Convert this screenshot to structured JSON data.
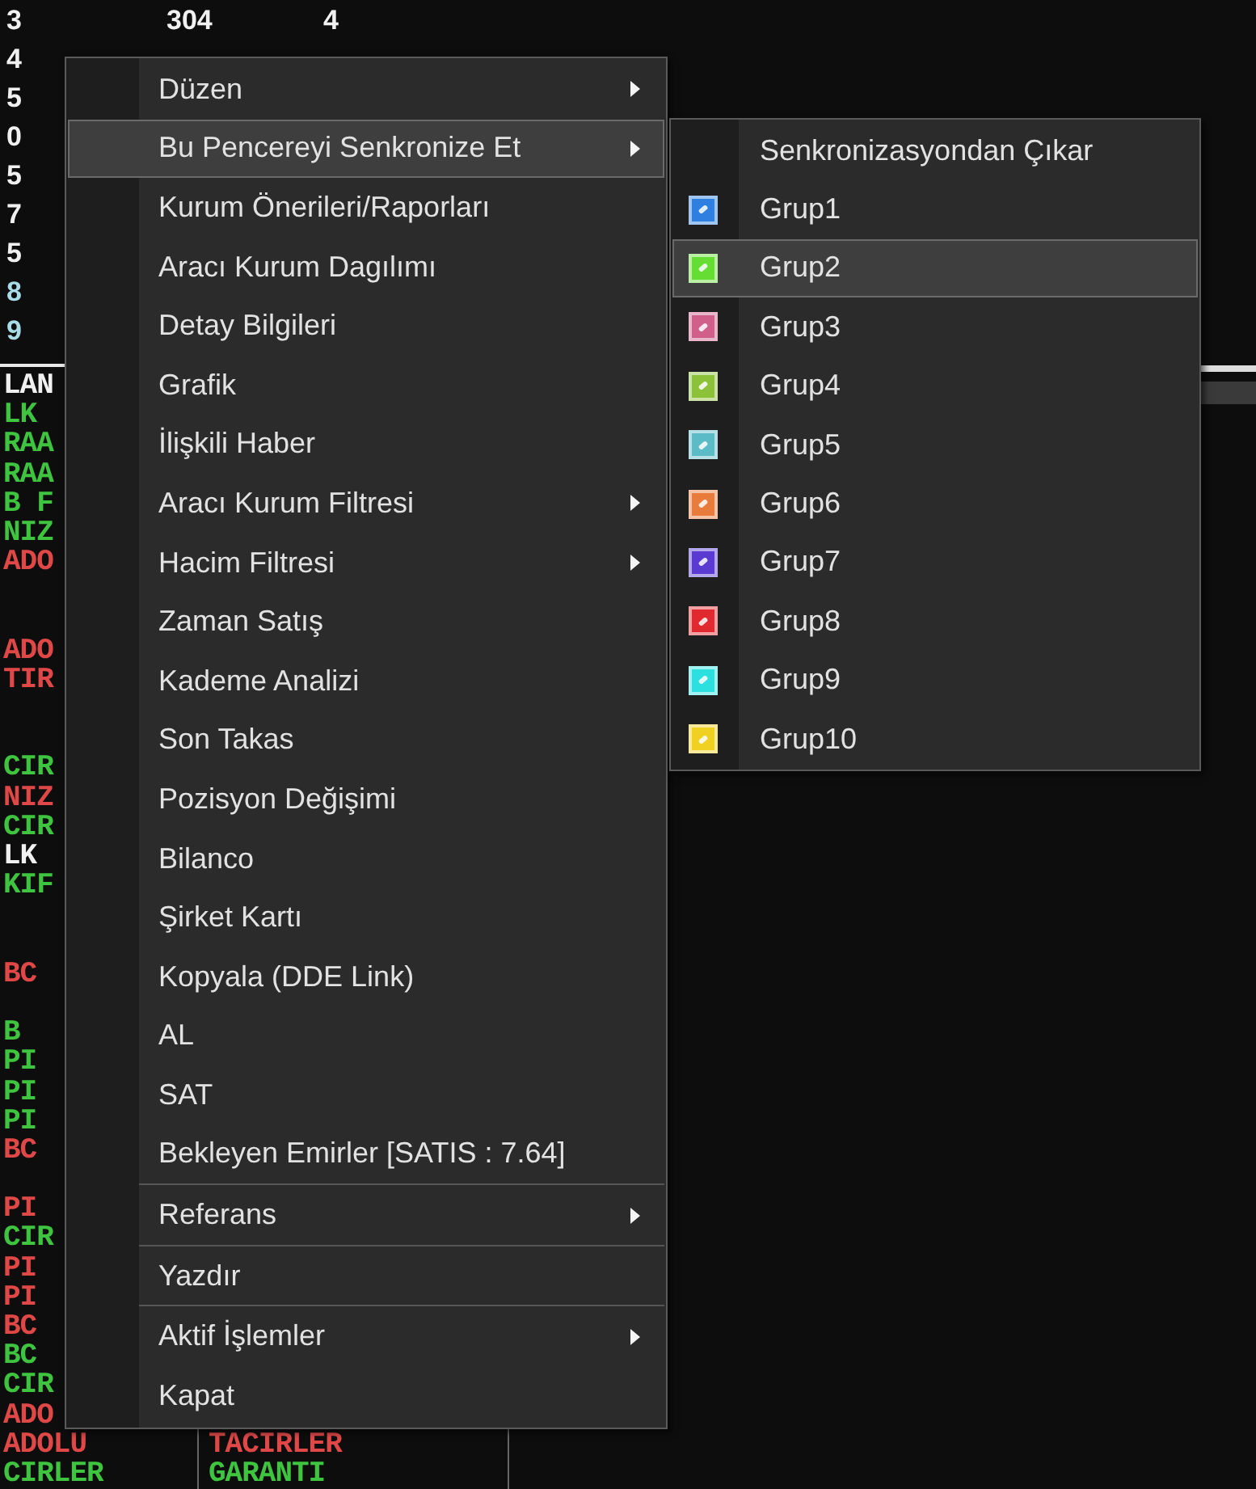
{
  "grid": {
    "top_rows": [
      {
        "cells": [
          "3",
          "304",
          "4"
        ],
        "color": "#f0f0f0"
      },
      {
        "cells": [
          "4"
        ],
        "color": "#f0f0f0"
      },
      {
        "cells": [
          "5"
        ],
        "color": "#f0f0f0"
      },
      {
        "cells": [
          "0"
        ],
        "color": "#f0f0f0"
      },
      {
        "cells": [
          "5"
        ],
        "color": "#f0f0f0"
      },
      {
        "cells": [
          "7"
        ],
        "color": "#f0f0f0"
      },
      {
        "cells": [
          "5"
        ],
        "color": "#f0f0f0"
      },
      {
        "cells": [
          "8"
        ],
        "color": "#a8dce6"
      },
      {
        "cells": [
          "9"
        ],
        "color": "#a8dce6"
      }
    ],
    "rows": [
      {
        "kind": "quote",
        "cells": [
          "LAN"
        ],
        "color": "#f0f0f0"
      },
      {
        "kind": "quote",
        "cells": [
          "LK"
        ],
        "color": "#3ec43e"
      },
      {
        "kind": "quote",
        "cells": [
          "RAA"
        ],
        "color": "#3ec43e"
      },
      {
        "kind": "quote",
        "cells": [
          "RAA"
        ],
        "color": "#3ec43e"
      },
      {
        "kind": "quote",
        "cells": [
          "B F"
        ],
        "color": "#3ec43e"
      },
      {
        "kind": "quote",
        "cells": [
          "NIZ"
        ],
        "color": "#3ec43e"
      },
      {
        "kind": "quote",
        "cells": [
          "ADO"
        ],
        "color": "#e04848"
      },
      {
        "kind": "empty"
      },
      {
        "kind": "empty"
      },
      {
        "kind": "quote",
        "cells": [
          "ADO"
        ],
        "color": "#e04848"
      },
      {
        "kind": "quote",
        "cells": [
          "TIR"
        ],
        "color": "#e04848"
      },
      {
        "kind": "empty"
      },
      {
        "kind": "empty"
      },
      {
        "kind": "quote",
        "cells": [
          "CIR"
        ],
        "color": "#3ec43e"
      },
      {
        "kind": "quote",
        "cells": [
          "NIZ"
        ],
        "color": "#e04848"
      },
      {
        "kind": "quote",
        "cells": [
          "CIR"
        ],
        "color": "#3ec43e"
      },
      {
        "kind": "quote",
        "cells": [
          "LK"
        ],
        "color": "#f0f0f0"
      },
      {
        "kind": "quote",
        "cells": [
          "KIF"
        ],
        "color": "#3ec43e"
      },
      {
        "kind": "empty"
      },
      {
        "kind": "empty"
      },
      {
        "kind": "quote",
        "cells": [
          "BC"
        ],
        "color": "#e04848"
      },
      {
        "kind": "empty"
      },
      {
        "kind": "quote",
        "cells": [
          "B"
        ],
        "color": "#3ec43e"
      },
      {
        "kind": "quote",
        "cells": [
          "PI"
        ],
        "color": "#3ec43e"
      },
      {
        "kind": "quote",
        "cells": [
          "PI"
        ],
        "color": "#3ec43e"
      },
      {
        "kind": "quote",
        "cells": [
          "PI"
        ],
        "color": "#3ec43e"
      },
      {
        "kind": "quote",
        "cells": [
          "BC"
        ],
        "color": "#e04848"
      },
      {
        "kind": "empty"
      },
      {
        "kind": "quote",
        "cells": [
          "PI"
        ],
        "color": "#e04848"
      },
      {
        "kind": "quote",
        "cells": [
          "CIR"
        ],
        "color": "#3ec43e"
      },
      {
        "kind": "quote",
        "cells": [
          "PI"
        ],
        "color": "#e04848"
      },
      {
        "kind": "quote",
        "cells": [
          "PI"
        ],
        "color": "#e04848"
      },
      {
        "kind": "quote",
        "cells": [
          "BC"
        ],
        "color": "#e04848"
      },
      {
        "kind": "quote",
        "cells": [
          "BC"
        ],
        "color": "#3ec43e"
      },
      {
        "kind": "quote",
        "cells": [
          "CIR"
        ],
        "color": "#3ec43e"
      },
      {
        "kind": "quote",
        "cells": [
          "ADO"
        ],
        "color": "#e04848"
      },
      {
        "kind": "quote",
        "cells": [
          "ADOLU",
          "TACIRLER"
        ],
        "color": "#e04848"
      },
      {
        "kind": "quote",
        "cells": [
          "CIRLER",
          "GARANTI"
        ],
        "color": "#3ec43e"
      }
    ]
  },
  "main_menu": {
    "items": [
      {
        "kind": "item",
        "label": "Düzen",
        "submenu": true,
        "selected": false
      },
      {
        "kind": "item",
        "label": "Bu Pencereyi Senkronize Et",
        "submenu": true,
        "selected": true
      },
      {
        "kind": "item",
        "label": "Kurum Önerileri/Raporları",
        "submenu": false,
        "selected": false
      },
      {
        "kind": "item",
        "label": "Aracı Kurum Dagılımı",
        "submenu": false,
        "selected": false
      },
      {
        "kind": "item",
        "label": "Detay Bilgileri",
        "submenu": false,
        "selected": false
      },
      {
        "kind": "item",
        "label": "Grafik",
        "submenu": false,
        "selected": false
      },
      {
        "kind": "item",
        "label": "İlişkili Haber",
        "submenu": false,
        "selected": false
      },
      {
        "kind": "item",
        "label": "Aracı Kurum Filtresi",
        "submenu": true,
        "selected": false
      },
      {
        "kind": "item",
        "label": "Hacim Filtresi",
        "submenu": true,
        "selected": false
      },
      {
        "kind": "item",
        "label": "Zaman Satış",
        "submenu": false,
        "selected": false
      },
      {
        "kind": "item",
        "label": "Kademe Analizi",
        "submenu": false,
        "selected": false
      },
      {
        "kind": "item",
        "label": "Son Takas",
        "submenu": false,
        "selected": false
      },
      {
        "kind": "item",
        "label": "Pozisyon Değişimi",
        "submenu": false,
        "selected": false
      },
      {
        "kind": "item",
        "label": "Bilanco",
        "submenu": false,
        "selected": false
      },
      {
        "kind": "item",
        "label": "Şirket Kartı",
        "submenu": false,
        "selected": false
      },
      {
        "kind": "item",
        "label": "Kopyala (DDE Link)",
        "submenu": false,
        "selected": false
      },
      {
        "kind": "item",
        "label": "AL",
        "submenu": false,
        "selected": false
      },
      {
        "kind": "item",
        "label": "SAT",
        "submenu": false,
        "selected": false
      },
      {
        "kind": "item",
        "label": "Bekleyen Emirler [SATIS : 7.64]",
        "submenu": false,
        "selected": false
      },
      {
        "kind": "separator"
      },
      {
        "kind": "item",
        "label": "Referans",
        "submenu": true,
        "selected": false
      },
      {
        "kind": "separator"
      },
      {
        "kind": "item",
        "label": "Yazdır",
        "submenu": false,
        "selected": false
      },
      {
        "kind": "separator"
      },
      {
        "kind": "item",
        "label": "Aktif İşlemler",
        "submenu": true,
        "selected": false
      },
      {
        "kind": "item",
        "label": "Kapat",
        "submenu": false,
        "selected": false
      }
    ]
  },
  "sync_submenu": {
    "items": [
      {
        "kind": "item",
        "label": "Senkronizasyondan Çıkar",
        "selected": false
      },
      {
        "kind": "item",
        "label": "Grup1",
        "color": "#2f7fe0",
        "selected": false
      },
      {
        "kind": "item",
        "label": "Grup2",
        "color": "#66dd33",
        "selected": true
      },
      {
        "kind": "item",
        "label": "Grup3",
        "color": "#d0608a",
        "selected": false
      },
      {
        "kind": "item",
        "label": "Grup4",
        "color": "#8cc23a",
        "selected": false
      },
      {
        "kind": "item",
        "label": "Grup5",
        "color": "#5bbcc8",
        "selected": false
      },
      {
        "kind": "item",
        "label": "Grup6",
        "color": "#e87c3c",
        "selected": false
      },
      {
        "kind": "item",
        "label": "Grup7",
        "color": "#5a3ad0",
        "selected": false
      },
      {
        "kind": "item",
        "label": "Grup8",
        "color": "#e02a30",
        "selected": false
      },
      {
        "kind": "item",
        "label": "Grup9",
        "color": "#2de0e0",
        "selected": false
      },
      {
        "kind": "item",
        "label": "Grup10",
        "color": "#f0d020",
        "selected": false
      }
    ]
  }
}
